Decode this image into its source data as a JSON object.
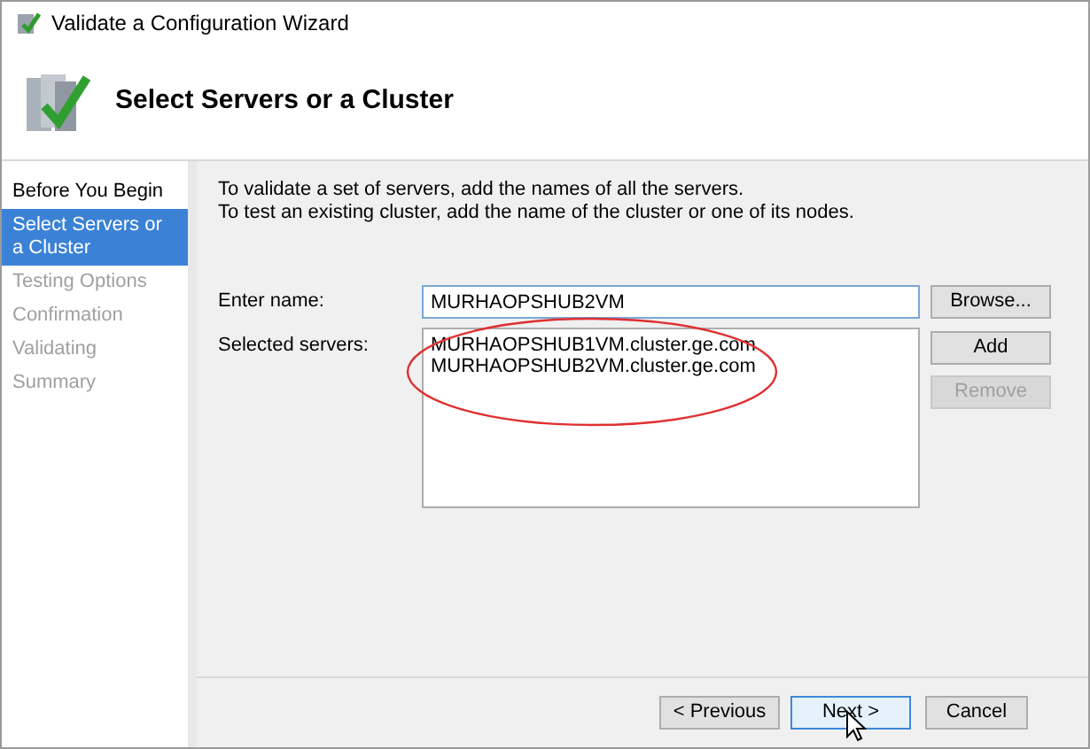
{
  "window": {
    "title": "Validate a Configuration Wizard"
  },
  "header": {
    "title": "Select Servers or a Cluster"
  },
  "steps": [
    {
      "label": "Before You Begin",
      "selected": false,
      "disabled": false
    },
    {
      "label": "Select Servers or a Cluster",
      "selected": true,
      "disabled": false
    },
    {
      "label": "Testing Options",
      "selected": false,
      "disabled": true
    },
    {
      "label": "Confirmation",
      "selected": false,
      "disabled": true
    },
    {
      "label": "Validating",
      "selected": false,
      "disabled": true
    },
    {
      "label": "Summary",
      "selected": false,
      "disabled": true
    }
  ],
  "instructions": [
    "To validate a set of servers, add the names of all the servers.",
    "To test an existing cluster, add the name of the cluster or one of its nodes."
  ],
  "name_field": {
    "label": "Enter name:",
    "value": "MURHAOPSHUB2VM"
  },
  "servers": {
    "label": "Selected servers:",
    "items": [
      "MURHAOPSHUB1VM.cluster.ge.com",
      "MURHAOPSHUB2VM.cluster.ge.com"
    ]
  },
  "side_buttons": [
    {
      "label": "Browse...",
      "disabled": false
    },
    {
      "label": "Add",
      "disabled": false
    },
    {
      "label": "Remove",
      "disabled": true
    }
  ],
  "footer_buttons": [
    {
      "label": "< Previous",
      "focused": false
    },
    {
      "label": "Next >",
      "focused": true
    },
    {
      "label": "Cancel",
      "focused": false
    }
  ]
}
